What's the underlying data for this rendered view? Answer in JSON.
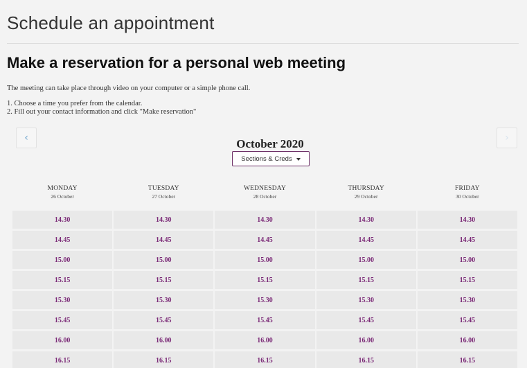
{
  "header": {
    "title": "Schedule an appointment"
  },
  "content": {
    "heading": "Make a reservation for a personal web meeting",
    "description": "The meeting can take place through video on your computer or a simple phone call.",
    "steps": [
      "1. Choose a time you prefer from the calendar.",
      "2. Fill out your contact information and click \"Make reservation\""
    ]
  },
  "calendar": {
    "month_label": "October 2020",
    "dropdown_selected": "Sections & Creds",
    "days": [
      {
        "name": "MONDAY",
        "date": "26 October"
      },
      {
        "name": "TUESDAY",
        "date": "27 October"
      },
      {
        "name": "WEDNESDAY",
        "date": "28 October"
      },
      {
        "name": "THURSDAY",
        "date": "29 October"
      },
      {
        "name": "FRIDAY",
        "date": "30 October"
      }
    ],
    "times": [
      "14.30",
      "14.45",
      "15.00",
      "15.15",
      "15.30",
      "15.45",
      "16.00",
      "16.15"
    ]
  },
  "icons": {
    "prev": "chevron-left-icon",
    "next": "chevron-right-icon",
    "dropdown": "caret-down-icon"
  },
  "colors": {
    "slot_text": "#7b2a77",
    "slot_bg": "#e9e9e9",
    "dropdown_border": "#6a2b63",
    "nav_arrow": "#6aa3cc",
    "page_bg": "#f3f3f3"
  }
}
